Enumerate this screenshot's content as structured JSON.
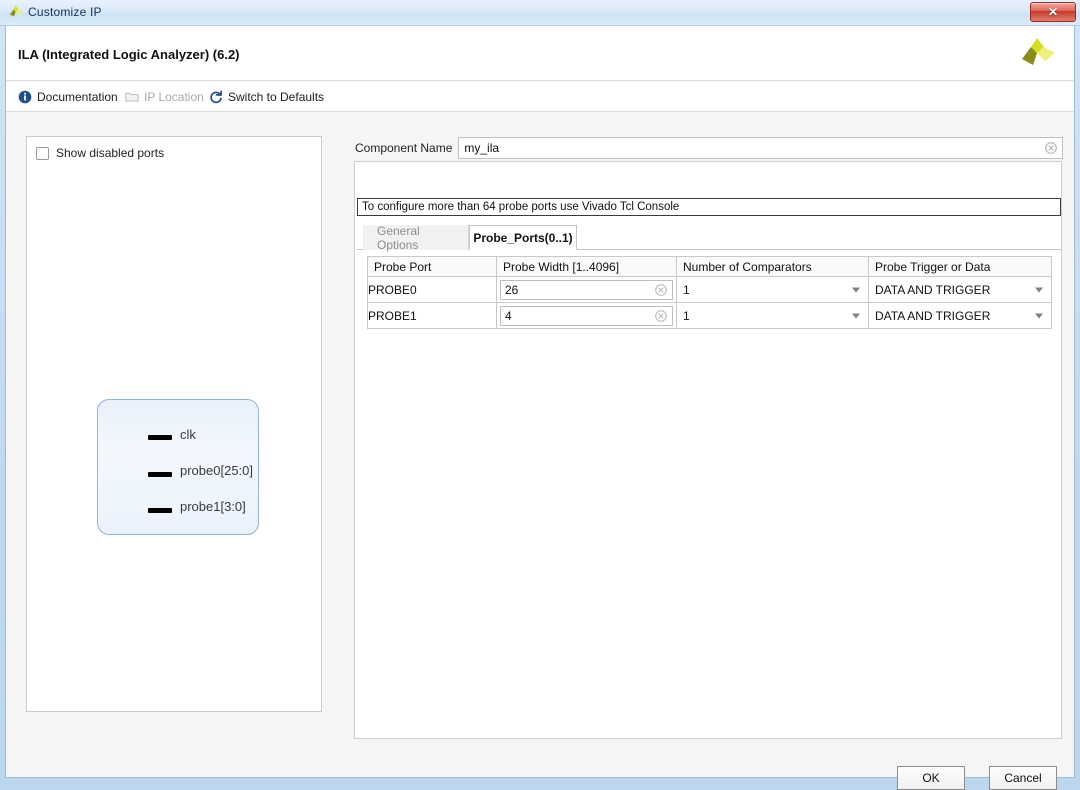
{
  "window": {
    "title": "Customize IP",
    "icon": "xilinx-logo-icon",
    "close_label": "✕"
  },
  "header": {
    "ip_title": "ILA (Integrated Logic Analyzer) (6.2)",
    "logo": "xilinx-logo"
  },
  "toolbar": {
    "items": [
      {
        "label": "Documentation",
        "icon": "info-icon",
        "enabled": true
      },
      {
        "label": "IP Location",
        "icon": "folder-icon",
        "enabled": false
      },
      {
        "label": "Switch to Defaults",
        "icon": "refresh-icon",
        "enabled": true
      }
    ]
  },
  "left_panel": {
    "show_disabled_ports": {
      "label": "Show disabled ports",
      "checked": false
    },
    "symbol": {
      "ports": [
        {
          "label": "clk"
        },
        {
          "label": "probe0[25:0]"
        },
        {
          "label": "probe1[3:0]"
        }
      ]
    }
  },
  "right_panel": {
    "component_name": {
      "label": "Component Name",
      "value": "my_ila",
      "placeholder": "",
      "clear_icon": "clear-circle-icon"
    },
    "message": "To configure more than 64 probe ports use Vivado Tcl Console",
    "tabs": [
      {
        "label": "General Options",
        "active": false
      },
      {
        "label": "Probe_Ports(0..1)",
        "active": true
      }
    ],
    "table": {
      "columns": [
        "Probe Port",
        "Probe Width [1..4096]",
        "Number of Comparators",
        "Probe Trigger or Data"
      ],
      "rows": [
        {
          "port": "PROBE0",
          "width": "26",
          "comparators": "1",
          "trigger_or_data": "DATA AND TRIGGER"
        },
        {
          "port": "PROBE1",
          "width": "4",
          "comparators": "1",
          "trigger_or_data": "DATA AND TRIGGER"
        }
      ]
    }
  },
  "footer": {
    "ok_label": "OK",
    "cancel_label": "Cancel"
  },
  "colors": {
    "window_frame": "#c3daf0",
    "client_bg": "#f5f5f5",
    "accent_link": "#1f4e8c",
    "logo_light": "#d7df23",
    "logo_dark": "#8a8c19",
    "close_red": "#c63a28"
  }
}
